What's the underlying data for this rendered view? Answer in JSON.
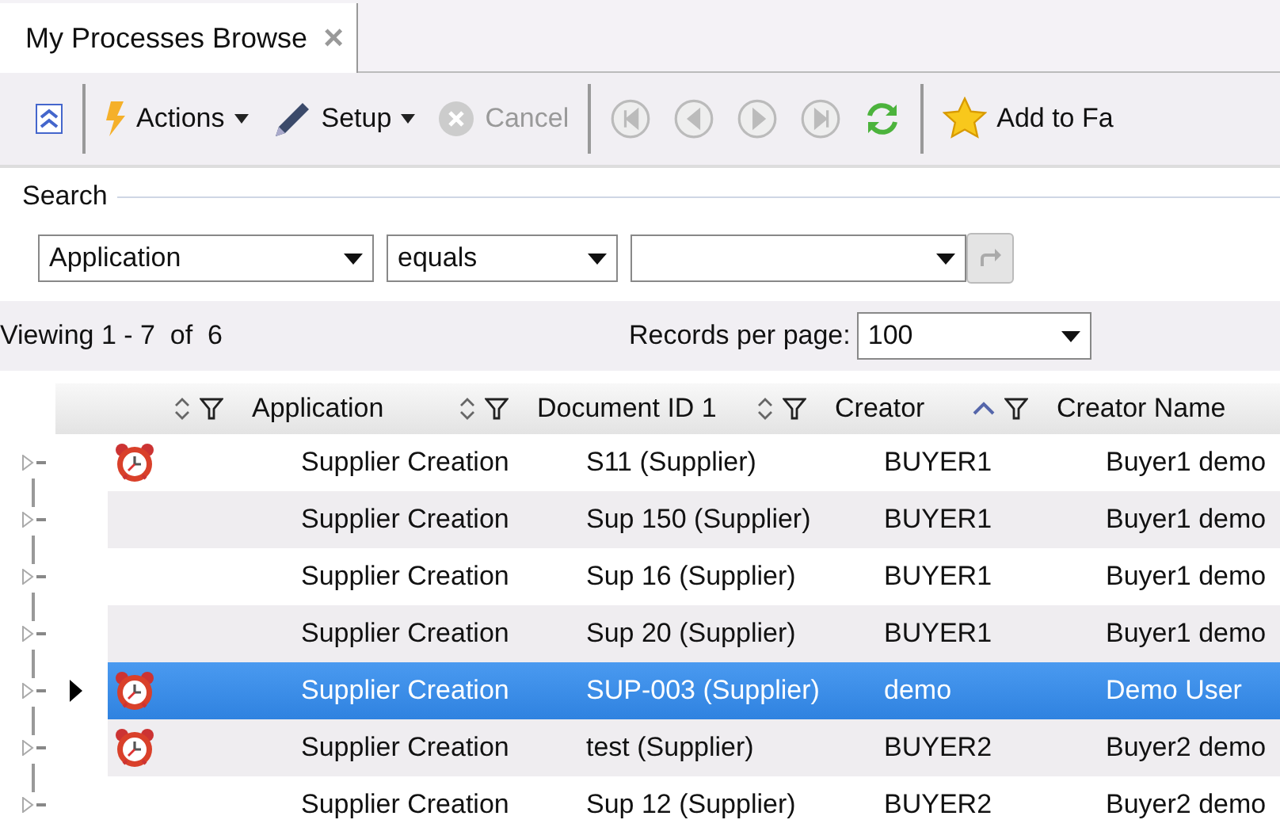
{
  "tab": {
    "title": "My Processes Browse",
    "close": "×"
  },
  "toolbar": {
    "groups": [
      [
        {
          "kind": "collapse",
          "disabled": false
        }
      ],
      [
        {
          "kind": "actions",
          "label": "Actions",
          "dropdown": true,
          "disabled": false
        },
        {
          "kind": "setup",
          "label": "Setup",
          "dropdown": true,
          "disabled": false
        },
        {
          "kind": "cancel",
          "label": "Cancel",
          "disabled": true
        }
      ],
      [
        {
          "kind": "first",
          "disabled": true
        },
        {
          "kind": "previous",
          "disabled": true
        },
        {
          "kind": "next",
          "disabled": true
        },
        {
          "kind": "last",
          "disabled": true
        },
        {
          "kind": "refresh",
          "disabled": false
        }
      ],
      [
        {
          "kind": "favorite",
          "label": "Add to Fa",
          "disabled": false
        }
      ]
    ]
  },
  "search": {
    "title": "Search",
    "filters": [
      {
        "kind": "combo",
        "value": "Application"
      },
      {
        "kind": "combo",
        "value": "equals"
      },
      {
        "kind": "combo"
      }
    ],
    "go_disabled": true
  },
  "paging": {
    "viewing": "Viewing 1 - 7  of  6",
    "records_label": "Records per page:",
    "records_value": "100"
  },
  "table": {
    "columns": [
      {
        "sorted_ascending": false
      },
      {
        "label": "Application",
        "sorted_ascending": false
      },
      {
        "label": "Document ID 1",
        "sorted_ascending": false
      },
      {
        "label": "Creator",
        "sorted_ascending": true
      },
      {
        "label": "Creator Name"
      }
    ],
    "rows": [
      {
        "alarm": true,
        "selected": false,
        "current": false,
        "application": "Supplier Creation",
        "document_id": "S11 (Supplier)",
        "creator": "BUYER1",
        "creator_name": "Buyer1 demo"
      },
      {
        "alarm": false,
        "selected": false,
        "current": false,
        "application": "Supplier Creation",
        "document_id": "Sup 150 (Supplier)",
        "creator": "BUYER1",
        "creator_name": "Buyer1 demo"
      },
      {
        "alarm": false,
        "selected": false,
        "current": false,
        "application": "Supplier Creation",
        "document_id": "Sup 16 (Supplier)",
        "creator": "BUYER1",
        "creator_name": "Buyer1 demo"
      },
      {
        "alarm": false,
        "selected": false,
        "current": false,
        "application": "Supplier Creation",
        "document_id": "Sup 20 (Supplier)",
        "creator": "BUYER1",
        "creator_name": "Buyer1 demo"
      },
      {
        "alarm": true,
        "selected": true,
        "current": true,
        "application": "Supplier Creation",
        "document_id": "SUP-003 (Supplier)",
        "creator": "demo",
        "creator_name": "Demo User"
      },
      {
        "alarm": true,
        "selected": false,
        "current": false,
        "application": "Supplier Creation",
        "document_id": "test (Supplier)",
        "creator": "BUYER2",
        "creator_name": "Buyer2 demo"
      },
      {
        "alarm": false,
        "selected": false,
        "current": false,
        "application": "Supplier Creation",
        "document_id": "Sup 12 (Supplier)",
        "creator": "BUYER2",
        "creator_name": "Buyer2 demo"
      }
    ]
  }
}
